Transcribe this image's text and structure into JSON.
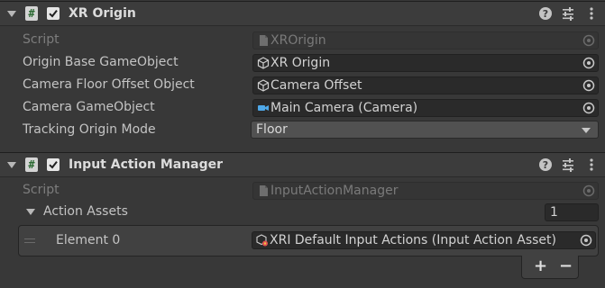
{
  "components": [
    {
      "title": "XR Origin",
      "enabled": true,
      "header_icons": [
        "help-icon",
        "presets-icon",
        "more-icon"
      ],
      "fields": [
        {
          "label": "Script",
          "value": "XROrigin",
          "icon": "script-file-icon",
          "disabled": true
        },
        {
          "label": "Origin Base GameObject",
          "value": "XR Origin",
          "icon": "gameobject-cube-icon"
        },
        {
          "label": "Camera Floor Offset Object",
          "value": "Camera Offset",
          "icon": "gameobject-cube-icon"
        },
        {
          "label": "Camera GameObject",
          "value": "Main Camera (Camera)",
          "icon": "camera-icon"
        }
      ],
      "dropdown": {
        "label": "Tracking Origin Mode",
        "value": "Floor"
      }
    },
    {
      "title": "Input Action Manager",
      "enabled": true,
      "header_icons": [
        "help-icon",
        "presets-icon",
        "more-icon"
      ],
      "script": {
        "label": "Script",
        "value": "InputActionManager",
        "icon": "script-file-icon",
        "disabled": true
      },
      "list": {
        "label": "Action Assets",
        "size": "1",
        "elements": [
          {
            "label": "Element 0",
            "value": "XRI Default Input Actions (Input Action Asset)",
            "icon": "input-action-asset-icon"
          }
        ],
        "add_label": "+",
        "remove_label": "−"
      }
    }
  ],
  "colors": {
    "background": "#383838",
    "header": "#3c3c3c",
    "field": "#2a2a2a",
    "dropdown": "#515151",
    "camera_icon": "#4fa8e8"
  }
}
